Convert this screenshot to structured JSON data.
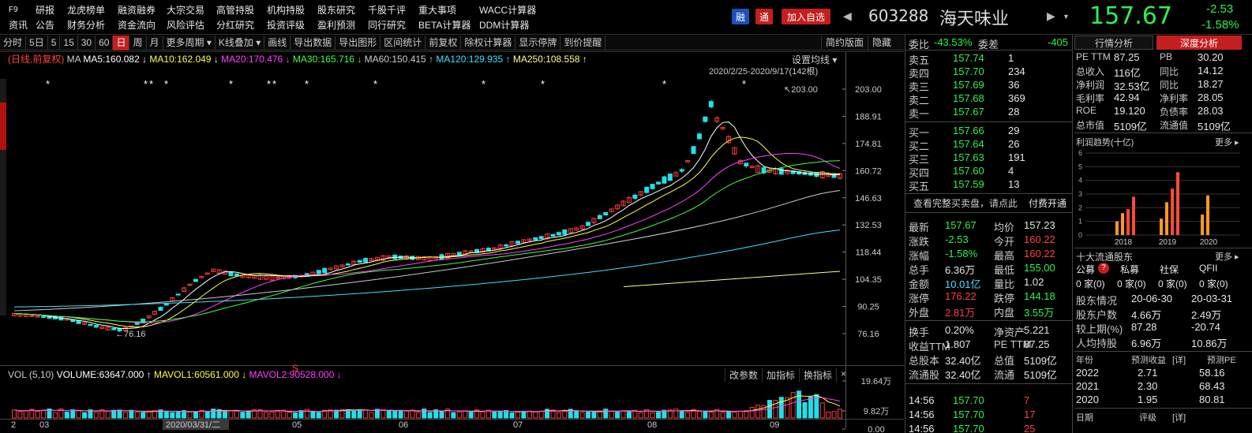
{
  "menu": {
    "row1": [
      "F9",
      "研报",
      "龙虎榜单",
      "融资融券",
      "大宗交易",
      "高管持股",
      "机构持股",
      "股东研究",
      "千股千评",
      "重大事项",
      "WACC计算器"
    ],
    "row2": [
      "资讯",
      "公告",
      "财务分析",
      "资金流向",
      "风险评估",
      "分红研究",
      "投资评级",
      "盈利预测",
      "同行研究",
      "BETA计算器",
      "DDM计算器"
    ]
  },
  "quote": {
    "tag_rong": "融",
    "tag_tong": "通",
    "add_watch": "加入自选",
    "code": "603288",
    "name": "海天味业",
    "price": "157.67",
    "chg": "-2.53",
    "chg_pct": "-1.58%"
  },
  "toolbar": {
    "items": [
      "分时",
      "5日",
      "5",
      "15",
      "30",
      "60",
      "日",
      "周",
      "月",
      "更多周期",
      "K线叠加",
      "画线",
      "导出数据",
      "导出图形",
      "区间统计",
      "前复权",
      "除权计算器",
      "显示停牌",
      "到价提醒"
    ],
    "active_index": 6,
    "right": [
      "简约版面",
      "隐藏"
    ]
  },
  "chart": {
    "period_label": "(日线,前复权)",
    "ma_label": "MA",
    "ma5": "MA5:160.082 ↓",
    "ma10": "MA10:162.049 ↓",
    "ma20": "MA20:170.476 ↓",
    "ma30": "MA30:165.716 ↓",
    "ma60": "MA60:150.415 ↑",
    "ma120": "MA120:129.935 ↑",
    "ma250": "MA250:108.558 ↑",
    "set_ma": "设置均线",
    "range": "2020/2/25-2020/9/17(142根)",
    "high_marker": "203.00",
    "low_marker": "76.16",
    "price_ticks": [
      "203.00",
      "188.91",
      "174.81",
      "160.72",
      "146.63",
      "132.53",
      "118.44",
      "104.35",
      "90.25",
      "76.16"
    ],
    "vol_legend": "VOL (5,10)",
    "volume": "VOLUME:63647.000 ↑",
    "mavol1": "MAVOL1:60561.000 ↓",
    "mavol2": "MAVOL2:90528.000 ↓",
    "vol_btns": [
      "改参数",
      "加指标",
      "换指标",
      "×"
    ],
    "vol_ticks": [
      "19.64万",
      "9.82万",
      "0.00"
    ],
    "x_labels": [
      "2",
      "03",
      "2020/03/31/二",
      "05",
      "06",
      "07",
      "08",
      "09"
    ],
    "s_marker": "S",
    "star": "*"
  },
  "orderbook": {
    "webi_label": "委比",
    "webi": "-43.53%",
    "wecha_label": "委差",
    "wecha": "-405",
    "sells": [
      {
        "label": "卖五",
        "price": "157.74",
        "vol": "1"
      },
      {
        "label": "卖四",
        "price": "157.70",
        "vol": "234"
      },
      {
        "label": "卖三",
        "price": "157.69",
        "vol": "36"
      },
      {
        "label": "卖二",
        "price": "157.68",
        "vol": "369"
      },
      {
        "label": "卖一",
        "price": "157.67",
        "vol": "28"
      }
    ],
    "buys": [
      {
        "label": "买一",
        "price": "157.66",
        "vol": "29"
      },
      {
        "label": "买二",
        "price": "157.64",
        "vol": "26"
      },
      {
        "label": "买三",
        "price": "157.63",
        "vol": "191"
      },
      {
        "label": "买四",
        "price": "157.60",
        "vol": "4"
      },
      {
        "label": "买五",
        "price": "157.59",
        "vol": "13"
      }
    ],
    "full_book": "查看完整买卖盘，请点此",
    "pay_open": "付费开通"
  },
  "stats": [
    [
      "最新",
      "157.67",
      "均价",
      "157.23"
    ],
    [
      "涨跌",
      "-2.53",
      "今开",
      "160.22"
    ],
    [
      "涨幅",
      "-1.58%",
      "最高",
      "160.22"
    ],
    [
      "总手",
      "6.36万",
      "最低",
      "155.00"
    ],
    [
      "金额",
      "10.01亿",
      "量比",
      "1.02"
    ],
    [
      "涨停",
      "176.22",
      "跌停",
      "144.18"
    ],
    [
      "外盘",
      "2.81万",
      "内盘",
      "3.55万"
    ]
  ],
  "stats2": [
    [
      "换手",
      "0.20%",
      "净资产",
      "5.221"
    ],
    [
      "收益TTM",
      "1.807",
      "PE TTM",
      "87.25"
    ],
    [
      "总股本",
      "32.40亿",
      "总值",
      "5109亿"
    ],
    [
      "流通股",
      "32.40亿",
      "流通",
      "5109亿"
    ]
  ],
  "ticks": [
    {
      "time": "14:56",
      "price": "157.70",
      "vol": "7"
    },
    {
      "time": "14:56",
      "price": "157.70",
      "vol": "17"
    },
    {
      "time": "14:56",
      "price": "157.70",
      "vol": "25"
    }
  ],
  "analysis": {
    "tab1": "行情分析",
    "tab2": "深度分析",
    "rows": [
      [
        "PE TTM",
        "87.25",
        "PB",
        "30.20"
      ],
      [
        "总收入",
        "116亿",
        "同比",
        "14.12"
      ],
      [
        "净利润",
        "32.53亿",
        "同比",
        "18.27"
      ],
      [
        "毛利率",
        "42.94",
        "净利率",
        "28.05"
      ],
      [
        "ROE",
        "19.120",
        "负债率",
        "28.03"
      ],
      [
        "总市值",
        "5109亿",
        "流通值",
        "5109亿"
      ]
    ],
    "profit_trend": "利润趋势(十亿)",
    "more": "更多",
    "bar_y": [
      "6",
      "5",
      "4",
      "3",
      "2",
      "1",
      "0"
    ],
    "years": [
      "2018",
      "2019",
      "2020"
    ],
    "bar_values": [
      [
        1.0,
        1.6,
        1.9,
        2.8
      ],
      [
        1.2,
        2.4,
        3.4,
        4.6
      ],
      [
        1.5,
        2.9
      ]
    ],
    "holders_title": "十大流通股东",
    "holder_types": [
      "公募",
      "私募",
      "社保",
      "QFII"
    ],
    "holder_vals": [
      "0 家(0)",
      "0 家(0)",
      "0 家(0)",
      "0 家(0)"
    ],
    "holder_rows": [
      [
        "股东情况",
        "20-06-30",
        "20-03-31"
      ],
      [
        "股东户数",
        "4.66万",
        "2.49万"
      ],
      [
        "较上期(%)",
        "87.28",
        "-20.74"
      ],
      [
        "人均持股",
        "6.96万",
        "10.86万"
      ]
    ],
    "forecast_head": [
      "年份",
      "预测收益",
      "[详]",
      "预测PE"
    ],
    "forecast": [
      [
        "2022",
        "2.71",
        "58.16"
      ],
      [
        "2021",
        "2.30",
        "68.43"
      ],
      [
        "2020",
        "1.95",
        "80.81"
      ]
    ],
    "footer": [
      "日期",
      "评级",
      "[详]"
    ]
  }
}
